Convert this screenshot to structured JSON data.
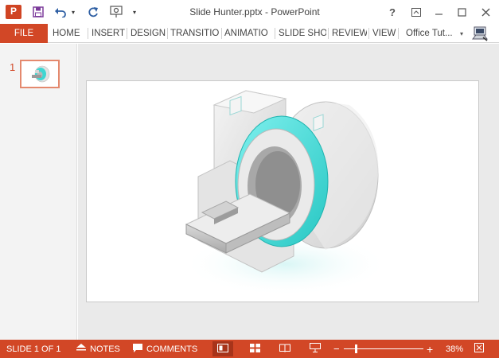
{
  "titlebar": {
    "title": "Slide Hunter.pptx - PowerPoint",
    "app_icon_letter": "P",
    "help": "?"
  },
  "ribbon": {
    "file": "FILE",
    "tabs": [
      "HOME",
      "INSERT",
      "DESIGN",
      "TRANSITIO",
      "ANIMATIO",
      "SLIDE SHO",
      "REVIEW",
      "VIEW"
    ],
    "account": "Office Tut..."
  },
  "thumbnails": {
    "slide_number": "1"
  },
  "statusbar": {
    "slide_indicator": "SLIDE 1 OF 1",
    "notes": "NOTES",
    "comments": "COMMENTS",
    "zoom_minus": "−",
    "zoom_plus": "+",
    "zoom": "38%",
    "zoom_fraction": 0.38
  },
  "colors": {
    "accent": "#d24726",
    "device_teal": "#3fd6d2",
    "device_body": "#e8e8e8"
  }
}
